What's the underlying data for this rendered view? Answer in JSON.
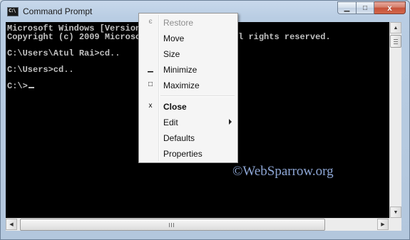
{
  "window": {
    "title": "Command Prompt",
    "icon": "cmd-icon",
    "icon_text": "C:\\"
  },
  "console": {
    "lines": [
      "Microsoft Windows [Version 6.1.7601]",
      "Copyright (c) 2009 Microsoft Corporation.  All rights reserved.",
      "",
      "C:\\Users\\Atul Rai>cd..",
      "",
      "C:\\Users>cd..",
      "",
      "C:\\>"
    ],
    "text_color": "#c0c0c0",
    "background": "#000000"
  },
  "watermark": "©WebSparrow.org",
  "context_menu": {
    "items": [
      {
        "label": "Restore",
        "icon": "restore-icon",
        "glyph": "є",
        "disabled": true
      },
      {
        "label": "Move",
        "icon": "",
        "glyph": ""
      },
      {
        "label": "Size",
        "icon": "",
        "glyph": ""
      },
      {
        "label": "Minimize",
        "icon": "minimize-icon",
        "glyph": "▁"
      },
      {
        "label": "Maximize",
        "icon": "maximize-icon",
        "glyph": "□"
      },
      {
        "label": "Close",
        "icon": "close-icon",
        "glyph": "x",
        "bold": true
      },
      {
        "label": "Edit",
        "icon": "",
        "glyph": "",
        "submenu": true
      },
      {
        "label": "Defaults",
        "icon": "",
        "glyph": ""
      },
      {
        "label": "Properties",
        "icon": "",
        "glyph": ""
      }
    ]
  },
  "controls": {
    "minimize_glyph": "▁",
    "maximize_glyph": "□",
    "close_glyph": "x",
    "scroll_up": "▲",
    "scroll_down": "▼",
    "scroll_left": "◀",
    "scroll_right": "▶"
  }
}
